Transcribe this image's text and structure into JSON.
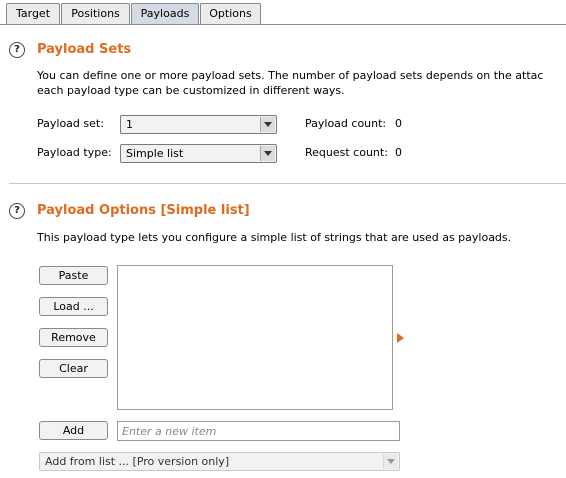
{
  "tabs": [
    {
      "label": "Target"
    },
    {
      "label": "Positions"
    },
    {
      "label": "Payloads"
    },
    {
      "label": "Options"
    }
  ],
  "active_tab": "Payloads",
  "payload_sets": {
    "title": "Payload Sets",
    "desc_line1": "You can define one or more payload sets. The number of payload sets depends on the attac",
    "desc_line2": "each payload type can be customized in different ways.",
    "set_label": "Payload set:",
    "set_value": "1",
    "type_label": "Payload type:",
    "type_value": "Simple list",
    "payload_count_label": "Payload count:",
    "payload_count": "0",
    "request_count_label": "Request count:",
    "request_count": "0"
  },
  "payload_options": {
    "title": "Payload Options [Simple list]",
    "desc": "This payload type lets you configure a simple list of strings that are used as payloads.",
    "buttons": {
      "paste": "Paste",
      "load": "Load ...",
      "remove": "Remove",
      "clear": "Clear",
      "add": "Add"
    },
    "new_item_placeholder": "Enter a new item",
    "add_from_list": "Add from list ... [Pro version only]"
  },
  "accent_color": "#e06a1e",
  "icons": {
    "help": "help-icon",
    "expand": "expand-arrow-icon"
  }
}
